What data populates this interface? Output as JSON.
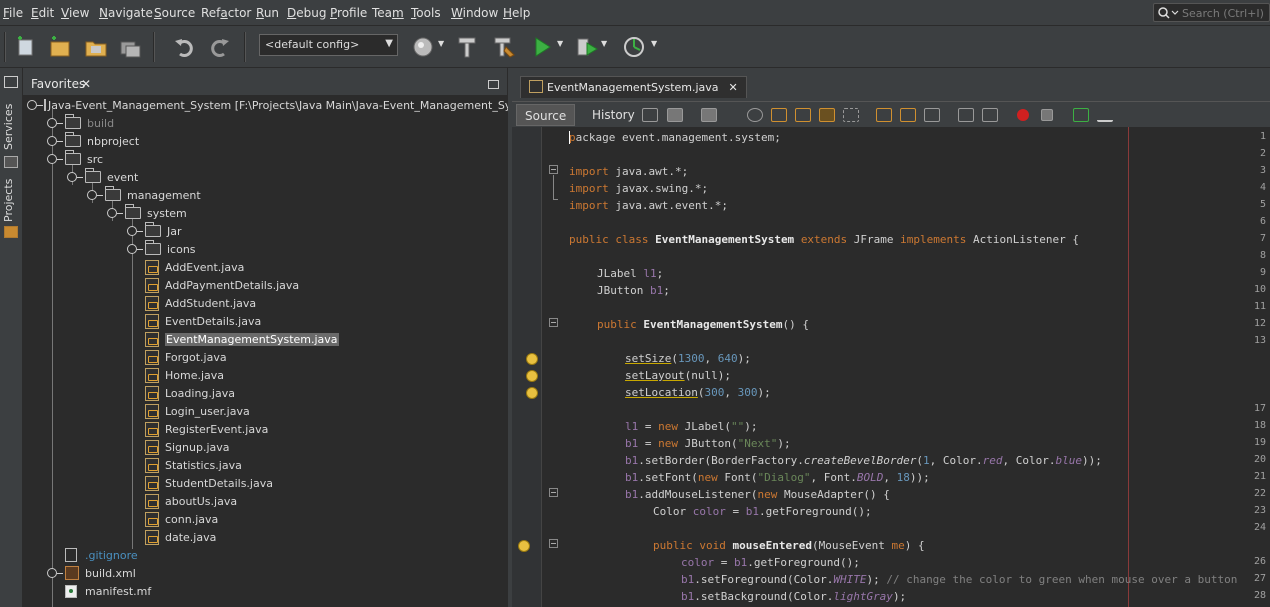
{
  "menubar": {
    "items": [
      {
        "label_u": "F",
        "label_rest": "ile"
      },
      {
        "label_u": "E",
        "label_rest": "dit"
      },
      {
        "label_u": "V",
        "label_rest": "iew"
      },
      {
        "label_u": "N",
        "label_rest": "avigate"
      },
      {
        "label_u": "S",
        "label_rest": "ource"
      },
      {
        "label_pre": "Ref",
        "label_u": "a",
        "label_rest": "ctor"
      },
      {
        "label_u": "R",
        "label_rest": "un"
      },
      {
        "label_u": "D",
        "label_rest": "ebug"
      },
      {
        "label_u": "P",
        "label_rest": "rofile"
      },
      {
        "label_pre": "Tea",
        "label_u": "m",
        "label_rest": ""
      },
      {
        "label_u": "T",
        "label_rest": "ools"
      },
      {
        "label_u": "W",
        "label_rest": "indow"
      },
      {
        "label_u": "H",
        "label_rest": "elp"
      }
    ],
    "search_placeholder": "Search (Ctrl+I)"
  },
  "toolbar": {
    "config": "<default config>"
  },
  "sidestrip": {
    "services": "Services",
    "projects": "Projects"
  },
  "favorites": {
    "tab_label": "Favorites",
    "close": "✕",
    "tree": {
      "root": "Java-Event_Management_System [F:\\Projects\\Java Main\\Java-Event_Management_System]",
      "build": "build",
      "nbproject": "nbproject",
      "src": "src",
      "event": "event",
      "management": "management",
      "system": "system",
      "jar": "Jar",
      "icons": "icons",
      "files": [
        "AddEvent.java",
        "AddPaymentDetails.java",
        "AddStudent.java",
        "EventDetails.java",
        "EventManagementSystem.java",
        "Forgot.java",
        "Home.java",
        "Loading.java",
        "Login_user.java",
        "RegisterEvent.java",
        "Signup.java",
        "Statistics.java",
        "StudentDetails.java",
        "aboutUs.java",
        "conn.java",
        "date.java"
      ],
      "gitignore": ".gitignore",
      "build_xml": "build.xml",
      "manifest": "manifest.mf"
    }
  },
  "editor": {
    "tab_label": "EventManagementSystem.java",
    "tab_close": "✕",
    "source_label": "Source",
    "history_label": "History",
    "line_numbers": [
      "1",
      "2",
      "3",
      "4",
      "5",
      "6",
      "7",
      "8",
      "9",
      "10",
      "11",
      "12",
      "13",
      "",
      "",
      "",
      "17",
      "18",
      "19",
      "20",
      "21",
      "22",
      "23",
      "24",
      "",
      "26",
      "27",
      "28"
    ],
    "code": {
      "l1": "ackage event.management.system;",
      "l1_p": "p",
      "l3_kw": "import",
      "l3": " java.awt.*;",
      "l4_kw": "import",
      "l4": " javax.swing.*;",
      "l5_kw": "import",
      "l5": " java.awt.event.*;",
      "l7_a": "public class",
      "l7_b": "EventManagementSystem",
      "l7_c": "extends",
      "l7_d": " JFrame ",
      "l7_e": "implements",
      "l7_f": " ActionListener {",
      "l9_a": "JLabel ",
      "l9_b": "l1",
      "l9_c": ";",
      "l10_a": "JButton ",
      "l10_b": "b1",
      "l10_c": ";",
      "l12_a": "public",
      "l12_b": "EventManagementSystem",
      "l12_c": "() {",
      "l14_a": "setSize",
      "l14_b": "(",
      "l14_c": "1300",
      "l14_d": ", ",
      "l14_e": "640",
      "l14_f": ");",
      "l15_a": "setLayout",
      "l15_b": "(null);",
      "l16_a": "setLocation",
      "l16_b": "(",
      "l16_c": "300",
      "l16_d": ", ",
      "l16_e": "300",
      "l16_f": ");",
      "l18_a": "l1",
      "l18_b": " = ",
      "l18_c": "new",
      "l18_d": " JLabel(",
      "l18_e": "\"\"",
      "l18_f": ");",
      "l19_a": "b1",
      "l19_b": " = ",
      "l19_c": "new",
      "l19_d": " JButton(",
      "l19_e": "\"Next\"",
      "l19_f": ");",
      "l20_a": "b1",
      "l20_b": ".setBorder(BorderFactory.",
      "l20_c": "createBevelBorder",
      "l20_d": "(",
      "l20_e": "1",
      "l20_f": ", Color.",
      "l20_g": "red",
      "l20_h": ", Color.",
      "l20_i": "blue",
      "l20_j": "));",
      "l21_a": "b1",
      "l21_b": ".setFont(",
      "l21_c": "new",
      "l21_d": " Font(",
      "l21_e": "\"Dialog\"",
      "l21_f": ", Font.",
      "l21_g": "BOLD",
      "l21_h": ", ",
      "l21_i": "18",
      "l21_j": "));",
      "l22_a": "b1",
      "l22_b": ".addMouseListener(",
      "l22_c": "new",
      "l22_d": " MouseAdapter() {",
      "l23_a": "Color ",
      "l23_b": "color",
      "l23_c": " = ",
      "l23_d": "b1",
      "l23_e": ".getForeground();",
      "l25_a": "public void",
      "l25_b": "mouseEntered",
      "l25_c": "(MouseEvent ",
      "l25_d": "me",
      "l25_e": ") {",
      "l26_a": "color",
      "l26_b": " = ",
      "l26_c": "b1",
      "l26_d": ".getForeground();",
      "l27_a": "b1",
      "l27_b": ".setForeground(Color.",
      "l27_c": "WHITE",
      "l27_d": "); ",
      "l27_e": "// change the color to green when mouse over a button",
      "l28_a": "b1",
      "l28_b": ".setBackground(Color.",
      "l28_c": "lightGray",
      "l28_d": ");"
    }
  }
}
